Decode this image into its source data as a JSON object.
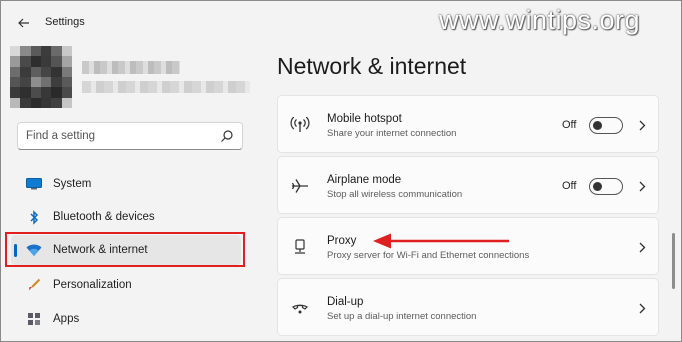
{
  "app": {
    "title": "Settings",
    "watermark": "www.wintips.org"
  },
  "search": {
    "placeholder": "Find a setting"
  },
  "sidebar": {
    "items": [
      {
        "label": "System",
        "icon": "monitor-icon"
      },
      {
        "label": "Bluetooth & devices",
        "icon": "bluetooth-icon"
      },
      {
        "label": "Network & internet",
        "icon": "wifi-icon",
        "active": true
      },
      {
        "label": "Personalization",
        "icon": "brush-icon"
      },
      {
        "label": "Apps",
        "icon": "apps-icon"
      }
    ]
  },
  "main": {
    "title": "Network & internet",
    "cards": [
      {
        "title": "Mobile hotspot",
        "desc": "Share your internet connection",
        "toggle_label": "Off",
        "icon": "hotspot-icon"
      },
      {
        "title": "Airplane mode",
        "desc": "Stop all wireless communication",
        "toggle_label": "Off",
        "icon": "airplane-icon"
      },
      {
        "title": "Proxy",
        "desc": "Proxy server for Wi-Fi and Ethernet connections",
        "icon": "proxy-icon"
      },
      {
        "title": "Dial-up",
        "desc": "Set up a dial-up internet connection",
        "icon": "dialup-icon"
      }
    ]
  },
  "colors": {
    "accent": "#0067c0",
    "annotation": "#e02020",
    "background": "#f3f3f3",
    "card": "#fbfbfb"
  }
}
